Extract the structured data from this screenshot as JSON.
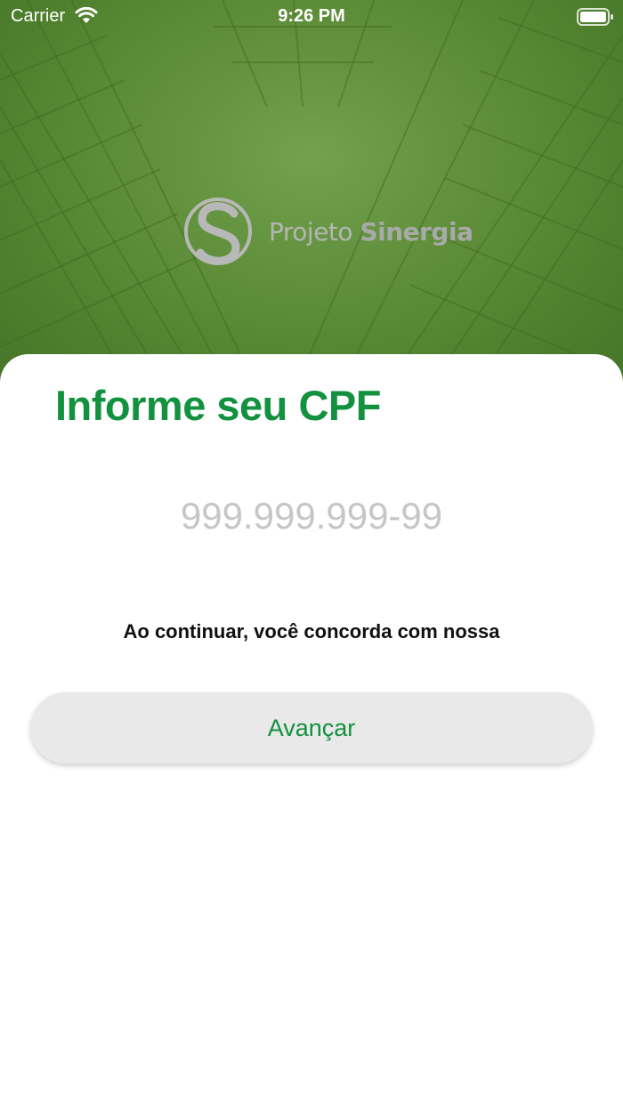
{
  "status_bar": {
    "carrier": "Carrier",
    "time": "9:26 PM",
    "wifi_icon": "wifi-icon",
    "battery_icon": "battery-icon"
  },
  "logo": {
    "text_regular": "Projeto ",
    "text_bold": "Sinergia"
  },
  "form": {
    "title": "Informe seu CPF",
    "cpf_placeholder": "999.999.999-99",
    "cpf_value": "",
    "terms_text": "Ao continuar, você concorda com nossa",
    "advance_label": "Avançar"
  },
  "colors": {
    "accent": "#12913f",
    "hero_green": "#5f8f3a",
    "button_bg": "#e9e9e9"
  }
}
